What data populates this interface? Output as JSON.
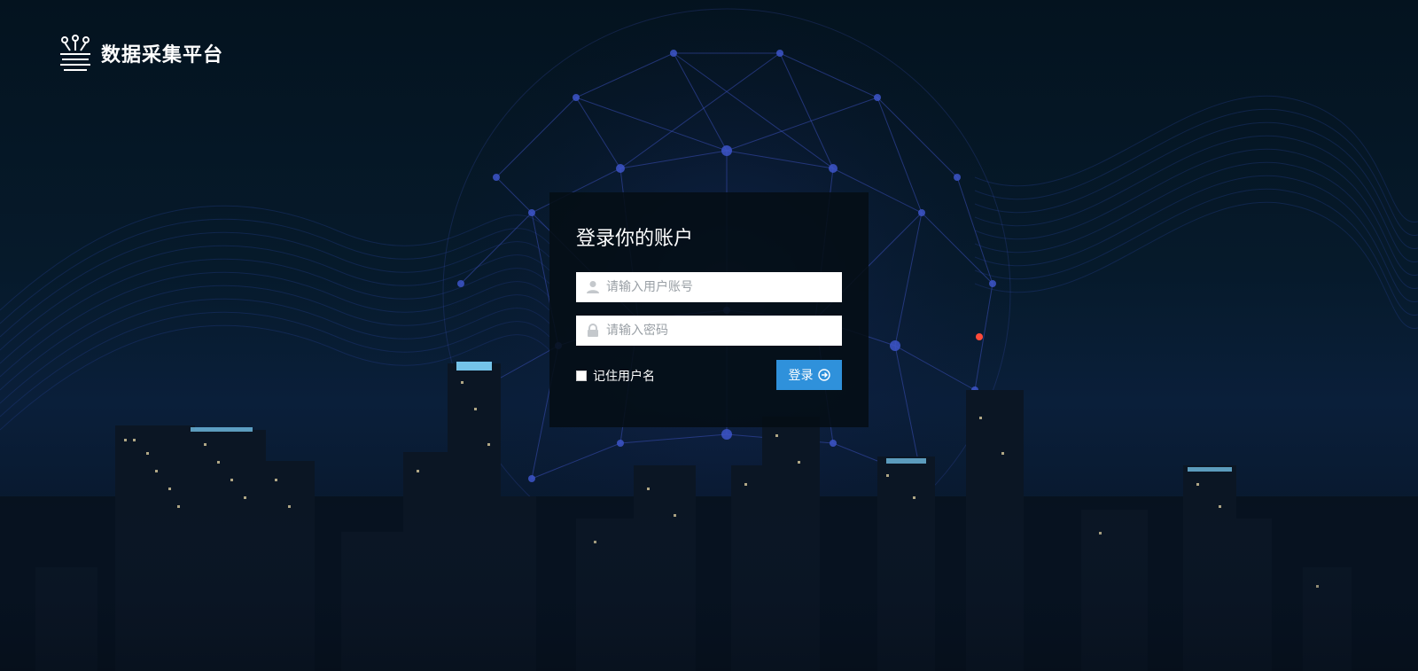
{
  "app": {
    "title": "数据采集平台"
  },
  "login": {
    "heading": "登录你的账户",
    "username_placeholder": "请输入用户账号",
    "password_placeholder": "请输入密码",
    "remember_label": "记住用户名",
    "submit_label": "登录"
  },
  "colors": {
    "background": "#04131f",
    "panel": "#050e14",
    "accent": "#2f91db",
    "network": "#3b4fb8"
  },
  "icons": {
    "logo": "data-platform-logo-icon",
    "username": "user-icon",
    "password": "lock-icon",
    "submit": "arrow-right-circle-icon"
  }
}
